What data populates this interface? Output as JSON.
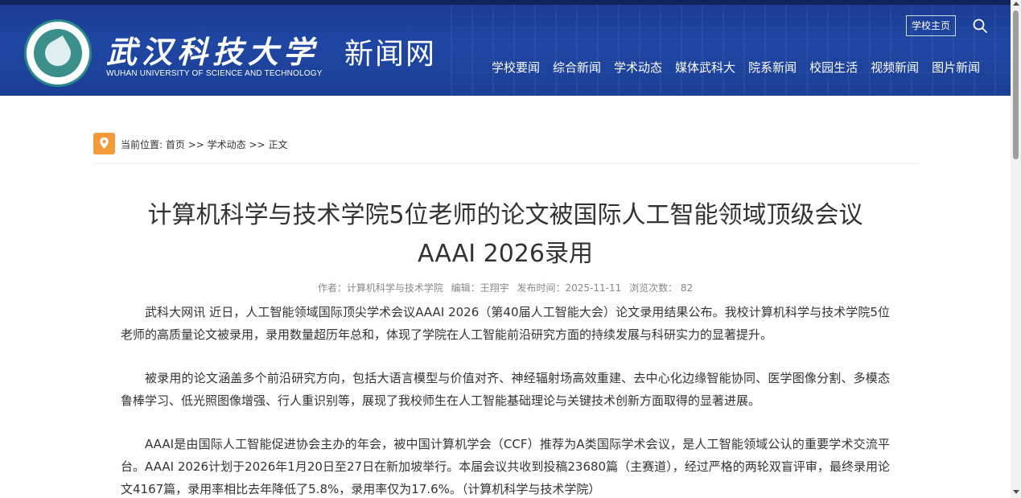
{
  "header": {
    "school_cn": "武汉科技大学",
    "school_en": "WUHAN UNIVERSITY OF SCIENCE AND TECHNOLOGY",
    "site_name": "新闻网",
    "home_button": "学校主页",
    "nav": [
      "学校要闻",
      "综合新闻",
      "学术动态",
      "媒体武科大",
      "院系新闻",
      "校园生活",
      "视频新闻",
      "图片新闻"
    ],
    "colors": {
      "header_bg": "#1f47a3",
      "accent_orange": "#f39a3a"
    }
  },
  "breadcrumb": {
    "label": "当前位置:",
    "home": "首页",
    "sep1": ">>",
    "section": "学术动态",
    "sep2": ">>",
    "current": "正文"
  },
  "article": {
    "title_line1": "计算机科学与技术学院5位老师的论文被国际人工智能领域顶级会议",
    "title_line2": "AAAI 2026录用",
    "meta": {
      "author": "作者：计算机科学与技术学院",
      "editor": "编辑：王翔宇",
      "date": "发布时间：2025-11-11",
      "views": "浏览次数： 82"
    },
    "paragraphs": [
      "武科大网讯 近日，人工智能领域国际顶尖学术会议AAAI 2026（第40届人工智能大会）论文录用结果公布。我校计算机科学与技术学院5位老师的高质量论文被录用，录用数量超历年总和，体现了学院在人工智能前沿研究方面的持续发展与科研实力的显著提升。",
      "被录用的论文涵盖多个前沿研究方向，包括大语言模型与价值对齐、神经辐射场高效重建、去中心化边缘智能协同、医学图像分割、多模态鲁棒学习、低光照图像增强、行人重识别等，展现了我校师生在人工智能基础理论与关键技术创新方面取得的显著进展。",
      "AAAI是由国际人工智能促进协会主办的年会，被中国计算机学会（CCF）推荐为A类国际学术会议，是人工智能领域公认的重要学术交流平台。AAAI 2026计划于2026年1月20日至27日在新加坡举行。本届会议共收到投稿23680篇（主赛道），经过严格的两轮双盲评审，最终录用论文4167篇，录用率相比去年降低了5.8%，录用率仅为17.6%。（计算机科学与技术学院）"
    ]
  }
}
